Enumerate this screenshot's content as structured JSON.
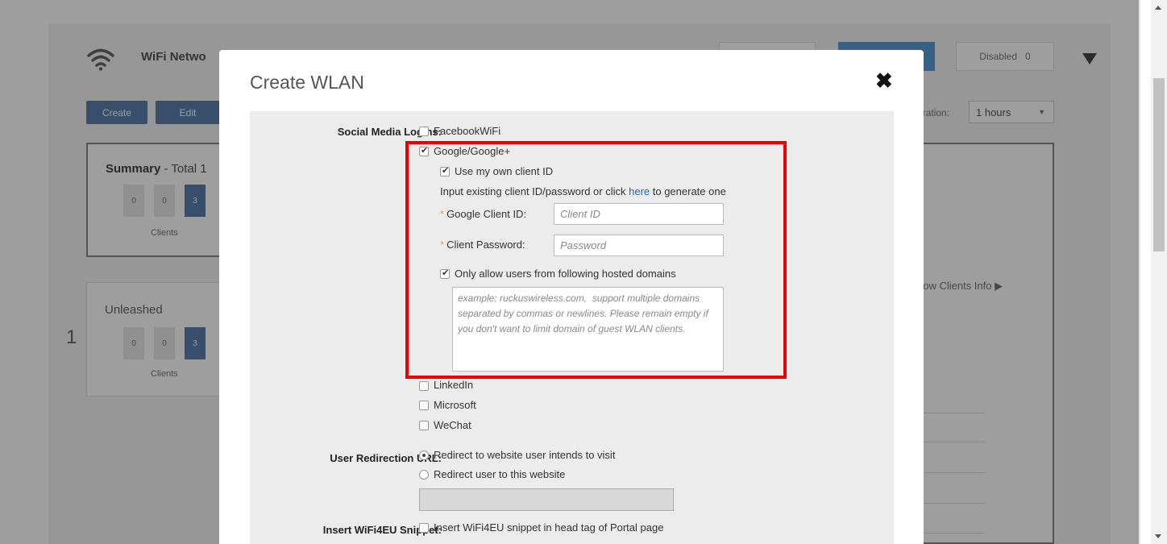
{
  "background": {
    "title": "WiFi Netwo",
    "buttons": {
      "create": "Create",
      "edit": "Edit"
    },
    "summary": {
      "title_bold": "Summary",
      "title_rest": " - Total 1",
      "counts": [
        "0",
        "0",
        "3"
      ],
      "clients_label": "Clients"
    },
    "unleashed": {
      "title": "Unleashed",
      "index": "1",
      "counts": [
        "0",
        "0",
        "3"
      ],
      "clients_label": "Clients"
    },
    "disabled": {
      "label": "Disabled",
      "count": "0"
    },
    "duration": {
      "label": "uration:",
      "value": "1 hours",
      "arrow": "▼"
    },
    "show_clients": "how Clients Info ▶"
  },
  "modal": {
    "title": "Create WLAN",
    "close": "✖",
    "social_media": {
      "label": "Social Media Logins:",
      "facebook": "FacebookWiFi",
      "google": "Google/Google+",
      "own_client_id": "Use my own client ID",
      "hint_pre": "Input existing client ID/password or click ",
      "hint_link": "here",
      "hint_post": " to generate one",
      "client_id_label": "Google Client ID:",
      "client_id_placeholder": "Client ID",
      "client_password_label": "Client Password:",
      "client_password_placeholder": "Password",
      "required_mark": "*",
      "hosted_domains": "Only allow users from following hosted domains",
      "domains_placeholder": "example: ruckuswireless.com,  support multiple domains separated by commas or newlines. Please remain empty if you don't want to limit domain of guest WLAN clients.",
      "linkedin": "LinkedIn",
      "microsoft": "Microsoft",
      "wechat": "WeChat"
    },
    "redirection": {
      "label": "User Redirection URL:",
      "intended": "Redirect to website user intends to visit",
      "this_website": "Redirect user to this website"
    },
    "wifi4eu": {
      "label": "Insert WiFi4EU Snippet:",
      "option": "Insert WiFi4EU snippet in head tag of Portal page"
    }
  },
  "colors": {
    "highlight": "#ee0000",
    "link": "#1a6fc4",
    "required": "#f0a030",
    "button": "#5b7fad"
  }
}
